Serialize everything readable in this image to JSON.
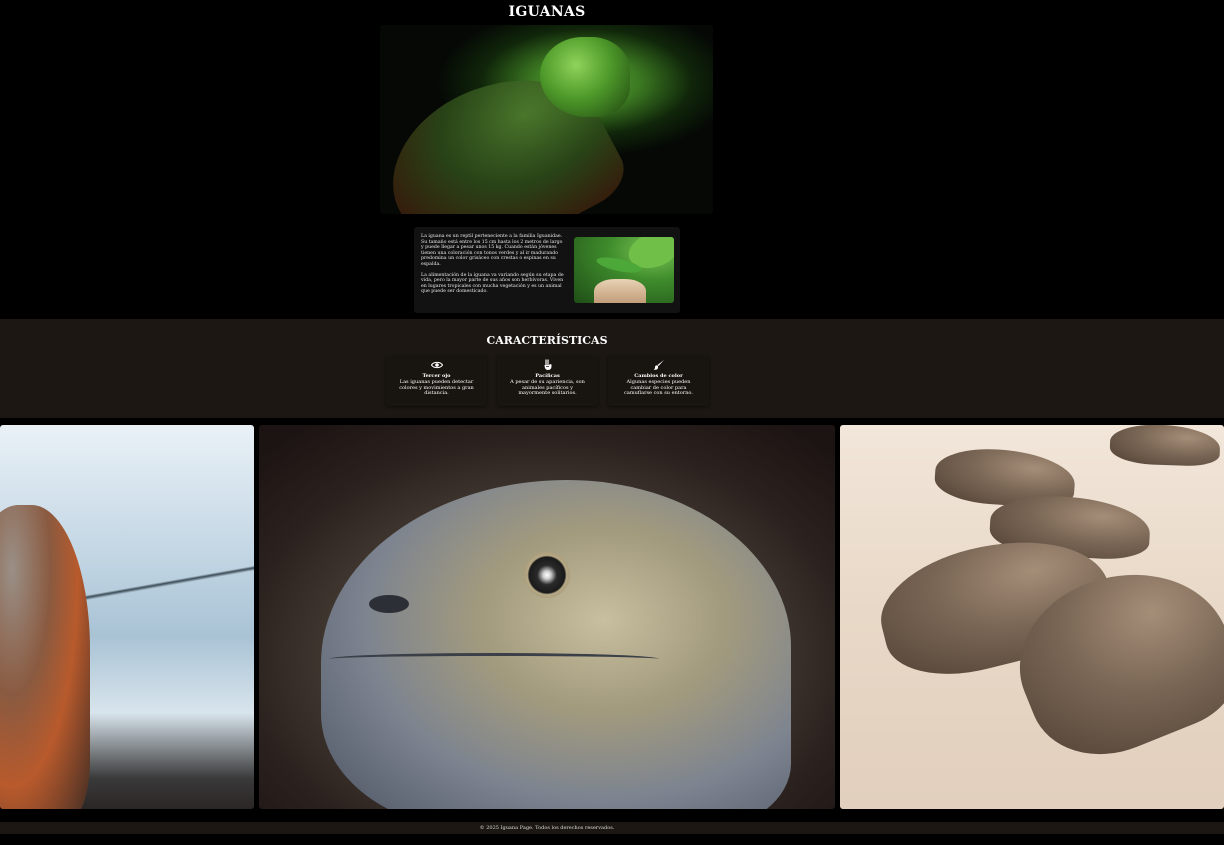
{
  "header": {
    "title": "IGUANAS"
  },
  "intro": {
    "paragraphs": [
      "La iguana es un reptil perteneciente a la familia Iguanidae. Su tamaño está entre los 15 cm hasta los 2 metros de largo y puede llegar a pesar unos 15 kg. Cuando están jóvenes tienen una coloración con tonos verdes y al ir madurando predomina un color grisáceo con crestas o espinas en su espalda.",
      "La alimentación de la iguana va variando según su etapa de vida, pero la mayor parte de sus años son herbívoras. Viven en lugares tropicales con mucha vegetación y es un animal que puede ser domesticado."
    ]
  },
  "features": {
    "title": "CARACTERÍSTICAS",
    "items": [
      {
        "icon": "eye-icon",
        "title": "Tercer ojo",
        "description": "Las iguanas pueden detectar colores y movimientos a gran distancia."
      },
      {
        "icon": "peace-hand-icon",
        "title": "Pacíficas",
        "description": "A pesar de su apariencia, son animales pacíficos y mayormente solitarios."
      },
      {
        "icon": "paintbrush-icon",
        "title": "Cambios de color",
        "description": "Algunas especies pueden cambiar de color para camuflarse con su entorno."
      }
    ]
  },
  "footer": {
    "text": "© 2025 Iguana Page. Todos los derechos reservados."
  }
}
